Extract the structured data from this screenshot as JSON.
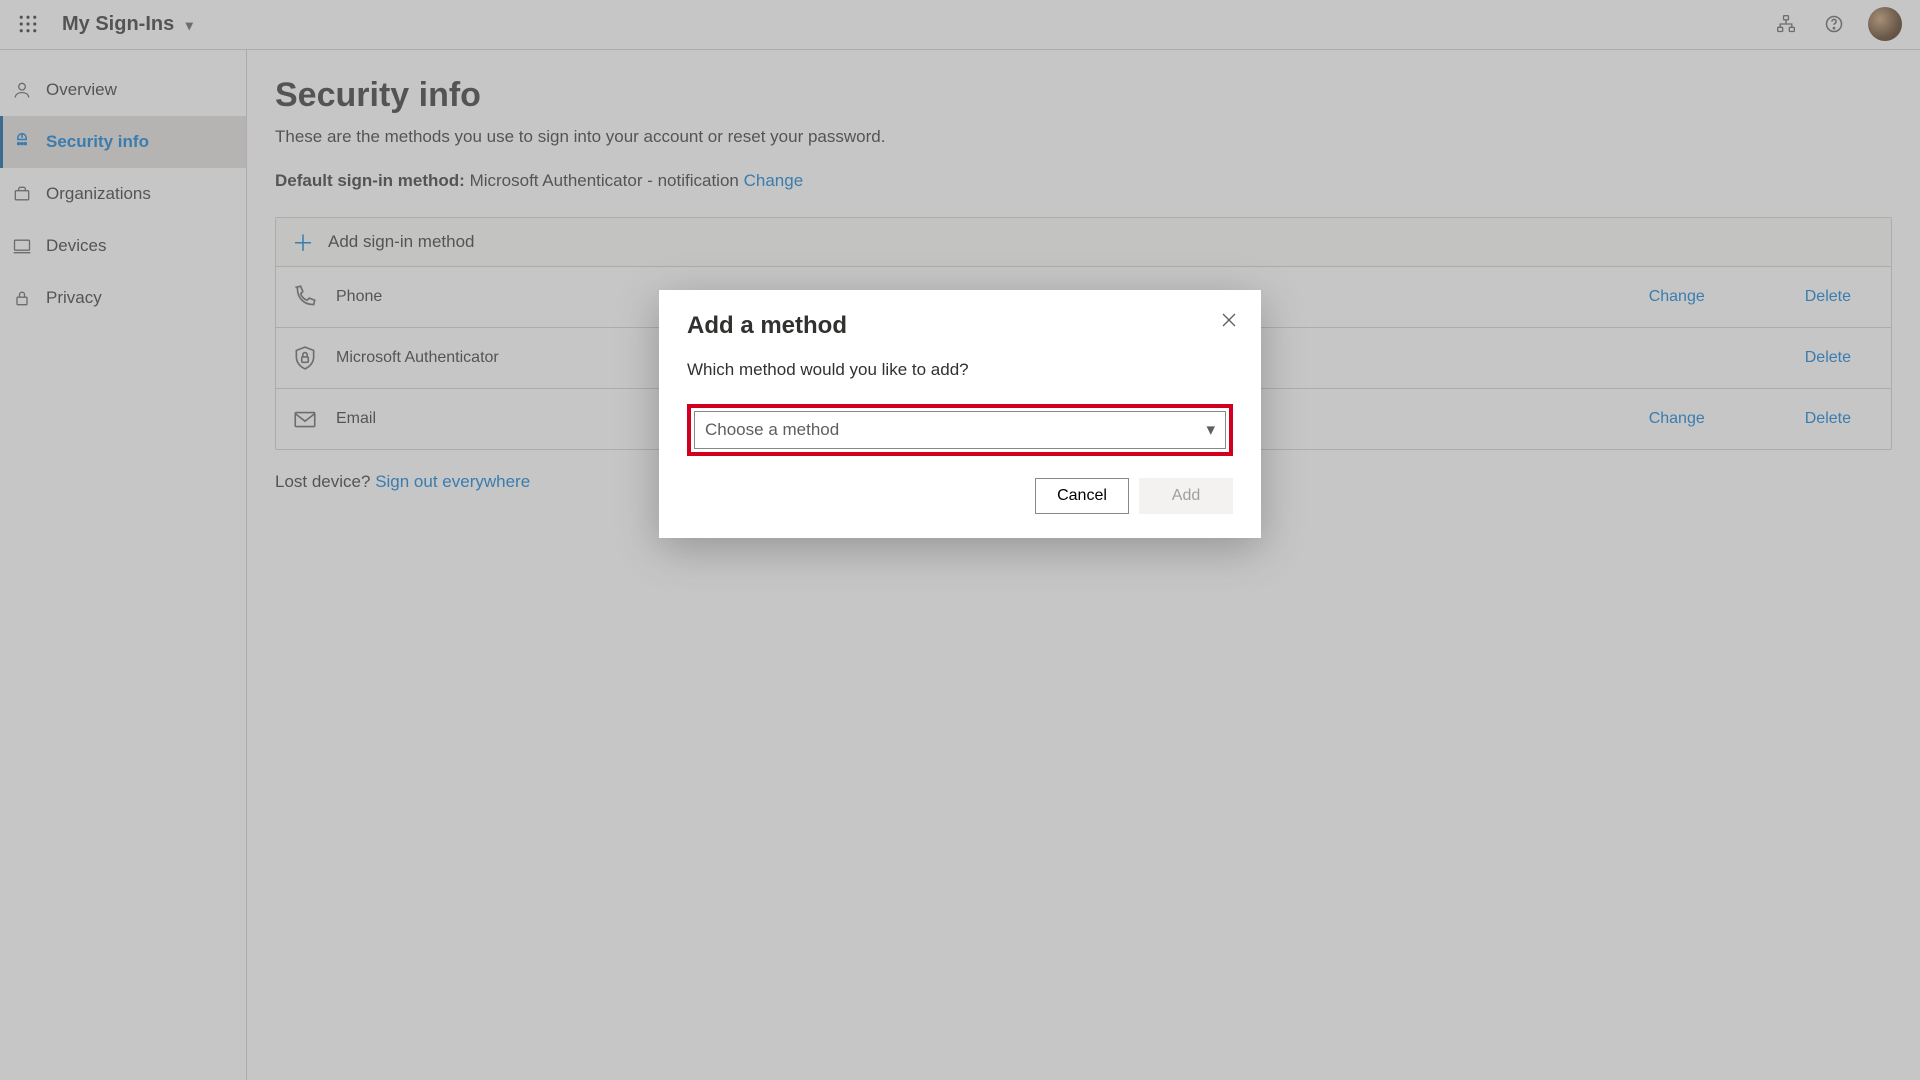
{
  "header": {
    "app_title": "My Sign-Ins"
  },
  "sidebar": {
    "items": [
      {
        "label": "Overview",
        "selected": false
      },
      {
        "label": "Security info",
        "selected": true
      },
      {
        "label": "Organizations",
        "selected": false
      },
      {
        "label": "Devices",
        "selected": false
      },
      {
        "label": "Privacy",
        "selected": false
      }
    ]
  },
  "page": {
    "title": "Security info",
    "subtitle": "These are the methods you use to sign into your account or reset your password.",
    "default_label": "Default sign-in method:",
    "default_value": "Microsoft Authenticator - notification",
    "change_link": "Change",
    "add_row_label": "Add sign-in method",
    "methods": [
      {
        "name": "Phone",
        "change": "Change",
        "delete": "Delete"
      },
      {
        "name": "Microsoft Authenticator",
        "change": "",
        "delete": "Delete"
      },
      {
        "name": "Email",
        "change": "Change",
        "delete": "Delete"
      }
    ],
    "lost_prompt": "Lost device?",
    "sign_out_link": "Sign out everywhere"
  },
  "dialog": {
    "title": "Add a method",
    "prompt": "Which method would you like to add?",
    "select_placeholder": "Choose a method",
    "cancel_label": "Cancel",
    "add_label": "Add"
  }
}
